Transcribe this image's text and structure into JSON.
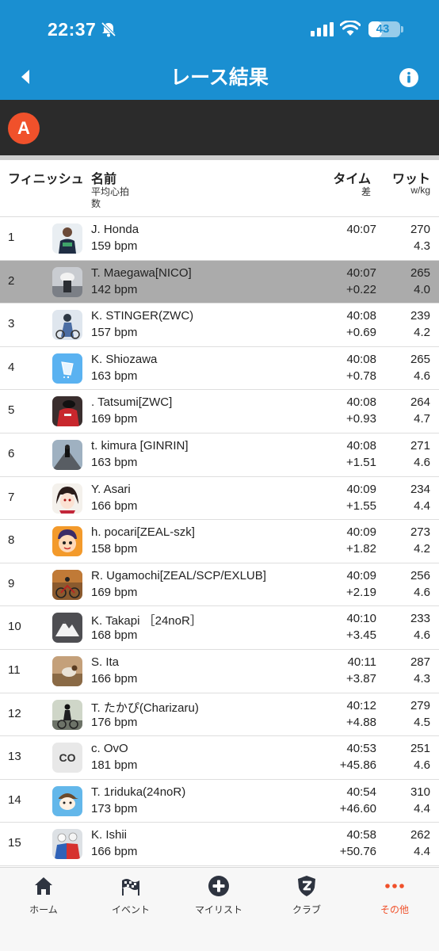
{
  "status_bar": {
    "time": "22:37",
    "battery": "43",
    "battery_level": 0.43
  },
  "header": {
    "title": "レース結果"
  },
  "category": {
    "badge": "A"
  },
  "columns": {
    "finish": "フィニッシュ",
    "name": "名前",
    "name_sub1": "平均心拍",
    "name_sub2": "数",
    "time": "タイム",
    "time_sub": "差",
    "watt": "ワット",
    "watt_sub": "w/kg"
  },
  "colors": {
    "header_blue": "#1a8fd1",
    "accent_orange": "#f0512b",
    "highlight_gray": "#ababab",
    "category_bar": "#2b2b2b"
  },
  "results": [
    {
      "rank": "1",
      "name": "J. Honda",
      "bpm": "159 bpm",
      "time": "40:07",
      "gap": "",
      "watt": "270",
      "wkg": "4.3",
      "avatar": "rider-photo",
      "highlight": false
    },
    {
      "rank": "2",
      "name": "T. Maegawa[NICO]",
      "bpm": "142 bpm",
      "time": "40:07",
      "gap": "+0.22",
      "watt": "265",
      "wkg": "4.0",
      "avatar": "tt-rider-photo",
      "highlight": true
    },
    {
      "rank": "3",
      "name": "K.  STINGER(ZWC)",
      "bpm": "157 bpm",
      "time": "40:08",
      "gap": "+0.69",
      "watt": "239",
      "wkg": "4.2",
      "avatar": "cyclist-photo",
      "highlight": false
    },
    {
      "rank": "4",
      "name": "K. Shiozawa",
      "bpm": "163 bpm",
      "time": "40:08",
      "gap": "+0.78",
      "watt": "265",
      "wkg": "4.6",
      "avatar": "cup-icon",
      "highlight": false
    },
    {
      "rank": "5",
      "name": ". Tatsumi[ZWC]",
      "bpm": "169 bpm",
      "time": "40:08",
      "gap": "+0.93",
      "watt": "264",
      "wkg": "4.7",
      "avatar": "red-kit-photo",
      "highlight": false
    },
    {
      "rank": "6",
      "name": "t. kimura [GINRIN]",
      "bpm": "163 bpm",
      "time": "40:08",
      "gap": "+1.51",
      "watt": "271",
      "wkg": "4.6",
      "avatar": "road-photo",
      "highlight": false
    },
    {
      "rank": "7",
      "name": "Y. Asari",
      "bpm": "166 bpm",
      "time": "40:09",
      "gap": "+1.55",
      "watt": "234",
      "wkg": "4.4",
      "avatar": "anime-character",
      "highlight": false
    },
    {
      "rank": "8",
      "name": "h. pocari[ZEAL-szk]",
      "bpm": "158 bpm",
      "time": "40:09",
      "gap": "+1.82",
      "watt": "273",
      "wkg": "4.2",
      "avatar": "cartoon-face",
      "highlight": false
    },
    {
      "rank": "9",
      "name": "R. Ugamochi[ZEAL/SCP/EXLUB]",
      "bpm": "169 bpm",
      "time": "40:09",
      "gap": "+2.19",
      "watt": "256",
      "wkg": "4.6",
      "avatar": "autumn-bike-photo",
      "highlight": false
    },
    {
      "rank": "10",
      "name": "K. Takapi ［24noR］",
      "bpm": "168 bpm",
      "time": "40:10",
      "gap": "+3.45",
      "watt": "233",
      "wkg": "4.6",
      "avatar": "mountain-logo",
      "highlight": false
    },
    {
      "rank": "11",
      "name": "S. Ita",
      "bpm": "166 bpm",
      "time": "40:11",
      "gap": "+3.87",
      "watt": "287",
      "wkg": "4.3",
      "avatar": "bird-photo",
      "highlight": false
    },
    {
      "rank": "12",
      "name": "T. たかぴ(Charizaru)",
      "bpm": "176 bpm",
      "time": "40:12",
      "gap": "+4.88",
      "watt": "279",
      "wkg": "4.5",
      "avatar": "bike-race-photo",
      "highlight": false
    },
    {
      "rank": "13",
      "name": "c. OvO",
      "bpm": "181 bpm",
      "time": "40:53",
      "gap": "+45.86",
      "watt": "251",
      "wkg": "4.6",
      "avatar": "initials",
      "initials": "CO",
      "highlight": false
    },
    {
      "rank": "14",
      "name": "T. 1riduka(24noR)",
      "bpm": "173 bpm",
      "time": "40:54",
      "gap": "+46.60",
      "watt": "310",
      "wkg": "4.4",
      "avatar": "cartoon-cap",
      "highlight": false
    },
    {
      "rank": "15",
      "name": "K. Ishii",
      "bpm": "166 bpm",
      "time": "40:58",
      "gap": "+50.76",
      "watt": "262",
      "wkg": "4.4",
      "avatar": "peloton-photo",
      "highlight": false
    }
  ],
  "tabs": [
    {
      "label": "ホーム",
      "icon": "home-icon",
      "active": false
    },
    {
      "label": "イベント",
      "icon": "checkered-flag-icon",
      "active": false
    },
    {
      "label": "マイリスト",
      "icon": "plus-circle-icon",
      "active": false
    },
    {
      "label": "クラブ",
      "icon": "club-shield-icon",
      "active": false
    },
    {
      "label": "その他",
      "icon": "more-dots-icon",
      "active": true
    }
  ]
}
